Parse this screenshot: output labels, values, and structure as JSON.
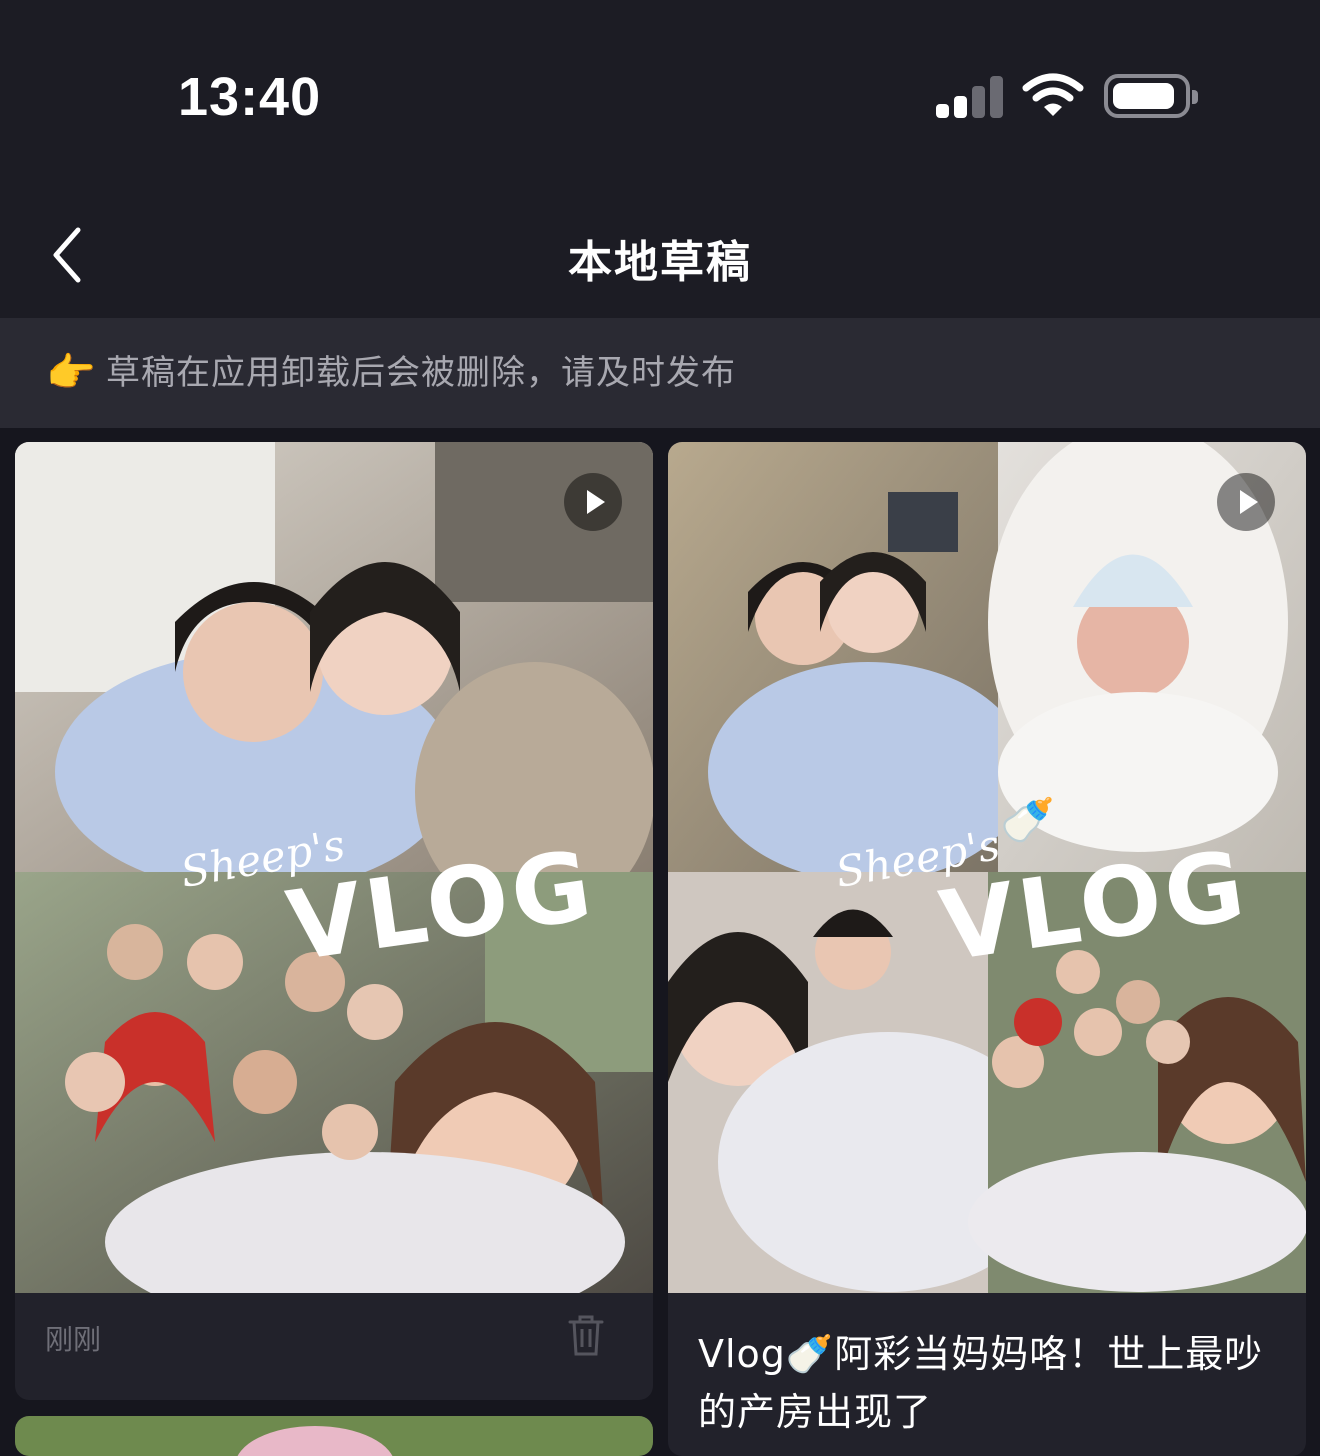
{
  "status_bar": {
    "time": "13:40",
    "icons": [
      "cellular-signal-icon",
      "wifi-icon",
      "battery-icon"
    ]
  },
  "nav": {
    "back_icon": "chevron-left-icon",
    "title": "本地草稿"
  },
  "notice": {
    "icon": "pointing-hand-icon",
    "text": "草稿在应用卸载后会被删除，请及时发布"
  },
  "drafts": [
    {
      "thumbnail_overlay": {
        "script": "Sheep's",
        "title": "VLOG"
      },
      "time": "刚刚",
      "icons": [
        "play-icon",
        "trash-icon"
      ]
    },
    {
      "thumbnail_overlay": {
        "script": "Sheep's",
        "title": "VLOG"
      },
      "caption": "Vlog🍼阿彩当妈妈咯！世上最吵的产房出现了",
      "icons": [
        "play-icon",
        "baby-bottle-icon"
      ]
    }
  ],
  "colors": {
    "background": "#16161e",
    "header": "#1c1c24",
    "notice_bg": "#2a2a33",
    "card_bg": "#22222b",
    "muted_text": "#6f6f78"
  }
}
